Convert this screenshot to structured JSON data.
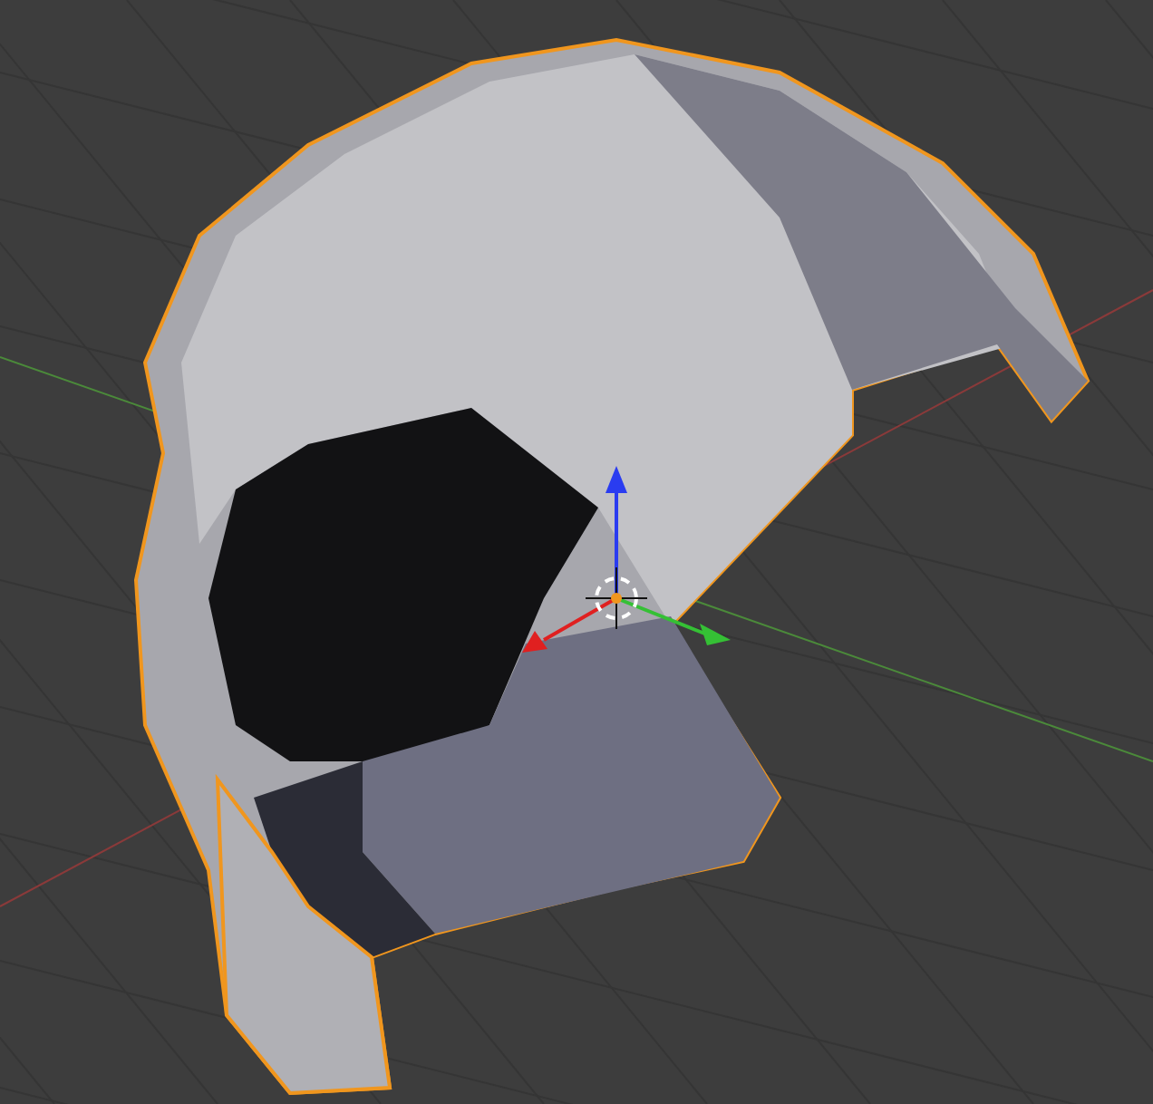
{
  "viewport": {
    "object_selected": true
  }
}
